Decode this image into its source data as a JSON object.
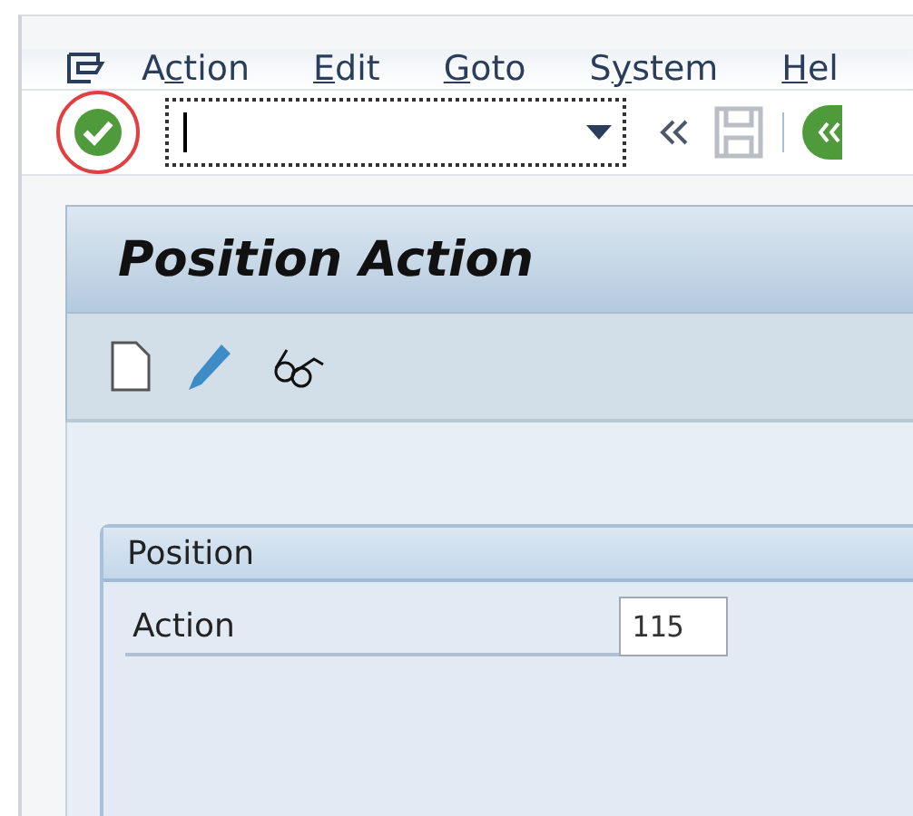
{
  "menu": [
    {
      "pre": "A",
      "mnemonic": "c",
      "post": "tion"
    },
    {
      "mnemonic": "E",
      "post": "dit"
    },
    {
      "mnemonic": "G",
      "post": "oto"
    },
    {
      "pre": "S",
      "mnemonic": "y",
      "post": "stem"
    },
    {
      "mnemonic": "H",
      "post": "el"
    }
  ],
  "screen_title": "Position Action",
  "group": {
    "title": "Position",
    "fields": [
      {
        "label": "Action",
        "value": "115"
      }
    ]
  }
}
